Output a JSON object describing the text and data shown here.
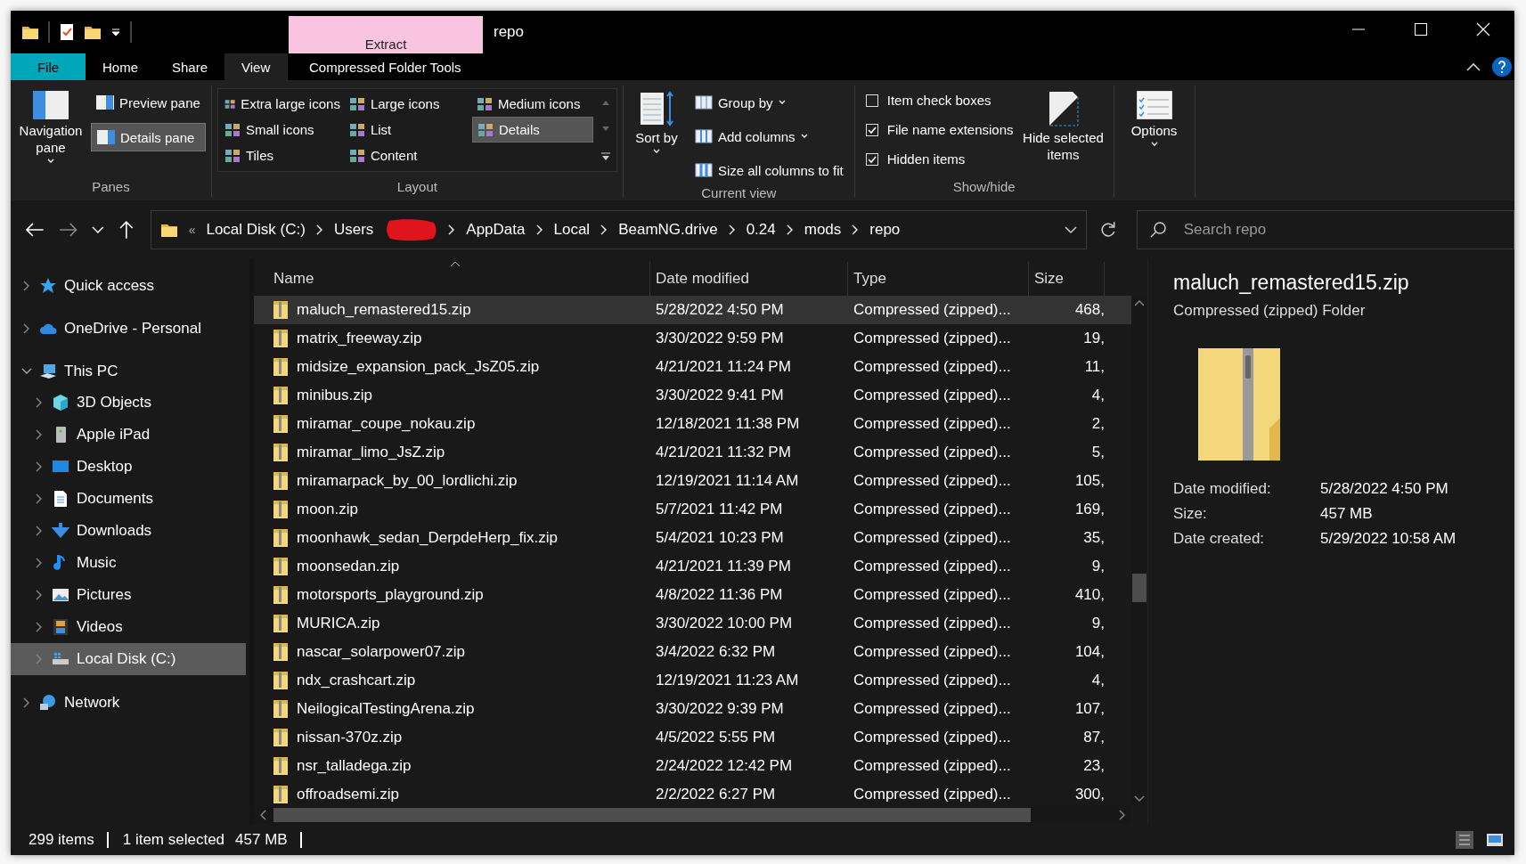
{
  "title_bar": {
    "contextual_header": "Extract",
    "title": "repo"
  },
  "ribbon_tabs": [
    {
      "label": "File",
      "kind": "file",
      "selected": false
    },
    {
      "label": "Home",
      "kind": "normal",
      "selected": false
    },
    {
      "label": "Share",
      "kind": "normal",
      "selected": false
    },
    {
      "label": "View",
      "kind": "normal",
      "selected": true
    },
    {
      "label": "Compressed Folder Tools",
      "kind": "contextual",
      "selected": false
    }
  ],
  "ribbon": {
    "panes": {
      "label": "Panes",
      "navigation_pane": "Navigation pane",
      "buttons": [
        {
          "label": "Preview pane",
          "selected": false
        },
        {
          "label": "Details pane",
          "selected": true
        }
      ]
    },
    "layout": {
      "label": "Layout",
      "options": [
        {
          "label": "Extra large icons",
          "selected": false
        },
        {
          "label": "Large icons",
          "selected": false
        },
        {
          "label": "Medium icons",
          "selected": false
        },
        {
          "label": "Small icons",
          "selected": false
        },
        {
          "label": "List",
          "selected": false
        },
        {
          "label": "Details",
          "selected": true
        },
        {
          "label": "Tiles",
          "selected": false
        },
        {
          "label": "Content",
          "selected": false
        }
      ]
    },
    "current_view": {
      "label": "Current view",
      "sort_by": "Sort by",
      "items": [
        {
          "label": "Group by",
          "dropdown": true
        },
        {
          "label": "Add columns",
          "dropdown": true
        },
        {
          "label": "Size all columns to fit",
          "dropdown": false
        }
      ]
    },
    "show_hide": {
      "label": "Show/hide",
      "checkboxes": [
        {
          "label": "Item check boxes",
          "checked": false
        },
        {
          "label": "File name extensions",
          "checked": true
        },
        {
          "label": "Hidden items",
          "checked": true
        }
      ],
      "hide_selected": "Hide selected items"
    },
    "options": {
      "label": "Options"
    }
  },
  "address_bar": {
    "overflow": "«",
    "segments": [
      {
        "kind": "text",
        "label": "Local Disk (C:)"
      },
      {
        "kind": "text",
        "label": "Users"
      },
      {
        "kind": "redacted"
      },
      {
        "kind": "text",
        "label": "AppData"
      },
      {
        "kind": "text",
        "label": "Local"
      },
      {
        "kind": "text",
        "label": "BeamNG.drive"
      },
      {
        "kind": "text",
        "label": "0.24"
      },
      {
        "kind": "text",
        "label": "mods"
      },
      {
        "kind": "text",
        "label": "repo"
      }
    ]
  },
  "search": {
    "placeholder": "Search repo"
  },
  "navigation": [
    {
      "label": "Quick access",
      "kind": "star",
      "expanded": false,
      "selected": false
    },
    {
      "label": "OneDrive - Personal",
      "kind": "cloud",
      "expanded": false,
      "selected": false
    },
    {
      "label": "This PC",
      "kind": "pc",
      "expanded": true,
      "selected": false,
      "children": [
        {
          "label": "3D Objects",
          "kind": "cube",
          "expanded": false,
          "selected": false
        },
        {
          "label": "Apple iPad",
          "kind": "device",
          "expanded": false,
          "selected": false
        },
        {
          "label": "Desktop",
          "kind": "desktop",
          "expanded": false,
          "selected": false
        },
        {
          "label": "Documents",
          "kind": "document",
          "expanded": false,
          "selected": false
        },
        {
          "label": "Downloads",
          "kind": "download",
          "expanded": false,
          "selected": false
        },
        {
          "label": "Music",
          "kind": "music",
          "expanded": false,
          "selected": false
        },
        {
          "label": "Pictures",
          "kind": "picture",
          "expanded": false,
          "selected": false
        },
        {
          "label": "Videos",
          "kind": "video",
          "expanded": false,
          "selected": false
        },
        {
          "label": "Local Disk (C:)",
          "kind": "disk",
          "expanded": false,
          "selected": true
        }
      ]
    },
    {
      "label": "Network",
      "kind": "network",
      "expanded": false,
      "selected": false
    }
  ],
  "files": {
    "columns": [
      "Name",
      "Date modified",
      "Type",
      "Size"
    ],
    "rows": [
      {
        "name": "maluch_remastered15.zip",
        "date": "5/28/2022 4:50 PM",
        "type": "Compressed (zipped)...",
        "size": "468,",
        "selected": true
      },
      {
        "name": "matrix_freeway.zip",
        "date": "3/30/2022 9:59 PM",
        "type": "Compressed (zipped)...",
        "size": "19,",
        "selected": false
      },
      {
        "name": "midsize_expansion_pack_JsZ05.zip",
        "date": "4/21/2021 11:24 PM",
        "type": "Compressed (zipped)...",
        "size": "11,",
        "selected": false
      },
      {
        "name": "minibus.zip",
        "date": "3/30/2022 9:41 PM",
        "type": "Compressed (zipped)...",
        "size": "4,",
        "selected": false
      },
      {
        "name": "miramar_coupe_nokau.zip",
        "date": "12/18/2021 11:38 PM",
        "type": "Compressed (zipped)...",
        "size": "2,",
        "selected": false
      },
      {
        "name": "miramar_limo_JsZ.zip",
        "date": "4/21/2021 11:32 PM",
        "type": "Compressed (zipped)...",
        "size": "5,",
        "selected": false
      },
      {
        "name": "miramarpack_by_00_lordlichi.zip",
        "date": "12/19/2021 11:14 AM",
        "type": "Compressed (zipped)...",
        "size": "105,",
        "selected": false
      },
      {
        "name": "moon.zip",
        "date": "5/7/2021 11:42 PM",
        "type": "Compressed (zipped)...",
        "size": "169,",
        "selected": false
      },
      {
        "name": "moonhawk_sedan_DerpdeHerp_fix.zip",
        "date": "5/4/2021 10:23 PM",
        "type": "Compressed (zipped)...",
        "size": "35,",
        "selected": false
      },
      {
        "name": "moonsedan.zip",
        "date": "4/21/2021 11:39 PM",
        "type": "Compressed (zipped)...",
        "size": "9,",
        "selected": false
      },
      {
        "name": "motorsports_playground.zip",
        "date": "4/8/2022 11:36 PM",
        "type": "Compressed (zipped)...",
        "size": "410,",
        "selected": false
      },
      {
        "name": "MURICA.zip",
        "date": "3/30/2022 10:00 PM",
        "type": "Compressed (zipped)...",
        "size": "9,",
        "selected": false
      },
      {
        "name": "nascar_solarpower07.zip",
        "date": "3/4/2022 6:32 PM",
        "type": "Compressed (zipped)...",
        "size": "104,",
        "selected": false
      },
      {
        "name": "ndx_crashcart.zip",
        "date": "12/19/2021 11:23 AM",
        "type": "Compressed (zipped)...",
        "size": "4,",
        "selected": false
      },
      {
        "name": "NeilogicalTestingArena.zip",
        "date": "3/30/2022 9:39 PM",
        "type": "Compressed (zipped)...",
        "size": "107,",
        "selected": false
      },
      {
        "name": "nissan-370z.zip",
        "date": "4/5/2022 5:55 PM",
        "type": "Compressed (zipped)...",
        "size": "87,",
        "selected": false
      },
      {
        "name": "nsr_talladega.zip",
        "date": "2/24/2022 12:42 PM",
        "type": "Compressed (zipped)...",
        "size": "23,",
        "selected": false
      },
      {
        "name": "offroadsemi.zip",
        "date": "2/2/2022 6:27 PM",
        "type": "Compressed (zipped)...",
        "size": "300,",
        "selected": false
      }
    ]
  },
  "preview": {
    "name": "maluch_remastered15.zip",
    "type": "Compressed (zipped) Folder",
    "fields": [
      {
        "label": "Date modified:",
        "value": "5/28/2022 4:50 PM"
      },
      {
        "label": "Size:",
        "value": "457 MB"
      },
      {
        "label": "Date created:",
        "value": "5/29/2022 10:58 AM"
      }
    ]
  },
  "status_bar": {
    "count": "299 items",
    "selection": "1 item selected",
    "size": "457 MB"
  }
}
